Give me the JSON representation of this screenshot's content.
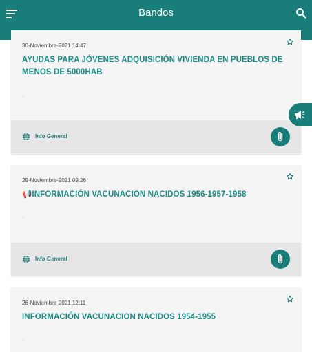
{
  "appbar": {
    "title": "Bandos"
  },
  "cards": [
    {
      "date": "30-Noviembre-2021 14:47",
      "title": "AYUDAS  PARA JÓVENES ADQUISICIÓN VIVIENDA EN PUEBLOS DE MENOS DE 5000HAB",
      "excerpt": ".",
      "category": "Info General"
    },
    {
      "date": "29-Noviembre-2021 09:26",
      "title": "INFORMACIÓN VACUNACION NACIDOS 1956-1957-1958",
      "title_prefix_emoji": "📢",
      "excerpt": ".",
      "category": "Info General"
    },
    {
      "date": "26-Noviembre-2021 12:11",
      "title": "INFORMACIÓN VACUNACION NACIDOS 1954-1955",
      "excerpt": "."
    }
  ],
  "icons": {
    "menu": "menu-icon",
    "search": "search-icon",
    "star": "star-outline-icon",
    "globe": "globe-icon",
    "attach": "paperclip-icon",
    "announce": "megaphone-icon"
  },
  "colors": {
    "primary": "#197e79",
    "title": "#1a8a84",
    "card_bg": "#f4f4f4",
    "footer_bg": "#e6e6e6"
  }
}
